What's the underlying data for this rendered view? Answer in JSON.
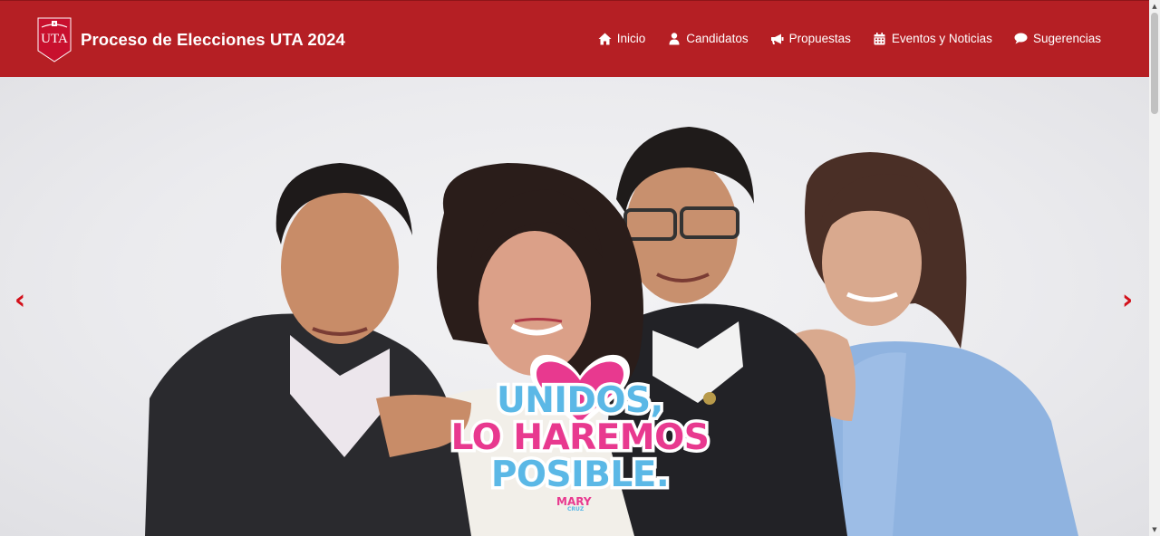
{
  "header": {
    "logo_text": "UTA",
    "title": "Proceso de Elecciones UTA 2024",
    "background_color": "#b51f24"
  },
  "nav": {
    "items": [
      {
        "label": "Inicio",
        "icon": "home-icon"
      },
      {
        "label": "Candidatos",
        "icon": "user-icon"
      },
      {
        "label": "Propuestas",
        "icon": "megaphone-icon"
      },
      {
        "label": "Eventos y Noticias",
        "icon": "calendar-icon"
      },
      {
        "label": "Sugerencias",
        "icon": "comment-icon"
      }
    ]
  },
  "carousel": {
    "prev_label": "‹",
    "next_label": "›",
    "arrow_color": "#d3101a",
    "slide": {
      "slogan_line1": "UNIDOS,",
      "slogan_line2": "LO HAREMOS",
      "slogan_line3": "POSIBLE.",
      "mark_name": "MARY",
      "mark_surname": "CRUZ",
      "heart_color": "#e8398f",
      "blue_color": "#5bb8e6"
    }
  }
}
